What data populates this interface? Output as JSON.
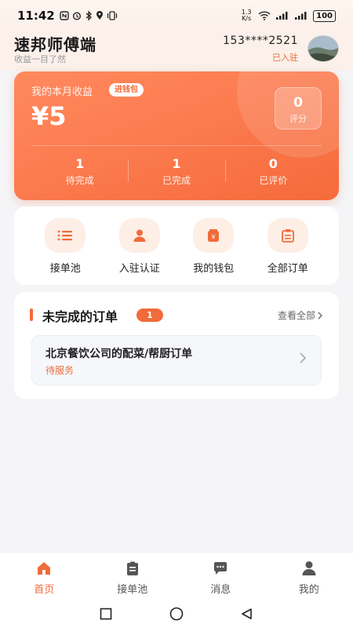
{
  "status_bar": {
    "time": "11:42",
    "net_speed": "1.3 K/s",
    "battery": "100"
  },
  "header": {
    "app_title": "速邦师傅端",
    "subtitle": "收益一目了然",
    "phone": "153****2521",
    "join_status": "已入驻"
  },
  "earnings": {
    "label": "我的本月收益",
    "wallet_chip": "进钱包",
    "amount": "¥5",
    "score_value": "0",
    "score_label": "评分",
    "stats": [
      {
        "value": "1",
        "label": "待完成"
      },
      {
        "value": "1",
        "label": "已完成"
      },
      {
        "value": "0",
        "label": "已评价"
      }
    ]
  },
  "quick_actions": [
    {
      "label": "接单池",
      "icon": "list-icon"
    },
    {
      "label": "入驻认证",
      "icon": "user-icon"
    },
    {
      "label": "我的钱包",
      "icon": "wallet-icon"
    },
    {
      "label": "全部订单",
      "icon": "clipboard-icon"
    }
  ],
  "orders": {
    "title": "未完成的订单",
    "badge": "1",
    "view_all": "查看全部",
    "items": [
      {
        "title": "北京餐饮公司的配菜/帮厨订单",
        "status": "待服务"
      }
    ]
  },
  "tabbar": {
    "tabs": [
      {
        "label": "首页",
        "icon": "home-icon",
        "active": true
      },
      {
        "label": "接单池",
        "icon": "clipboard-icon",
        "active": false
      },
      {
        "label": "消息",
        "icon": "chat-icon",
        "active": false
      },
      {
        "label": "我的",
        "icon": "person-icon",
        "active": false
      }
    ]
  },
  "colors": {
    "accent": "#f26b3a",
    "card_gradient_start": "#ff8a5e",
    "card_gradient_end": "#f56a3a",
    "background": "#f5f5f7"
  }
}
